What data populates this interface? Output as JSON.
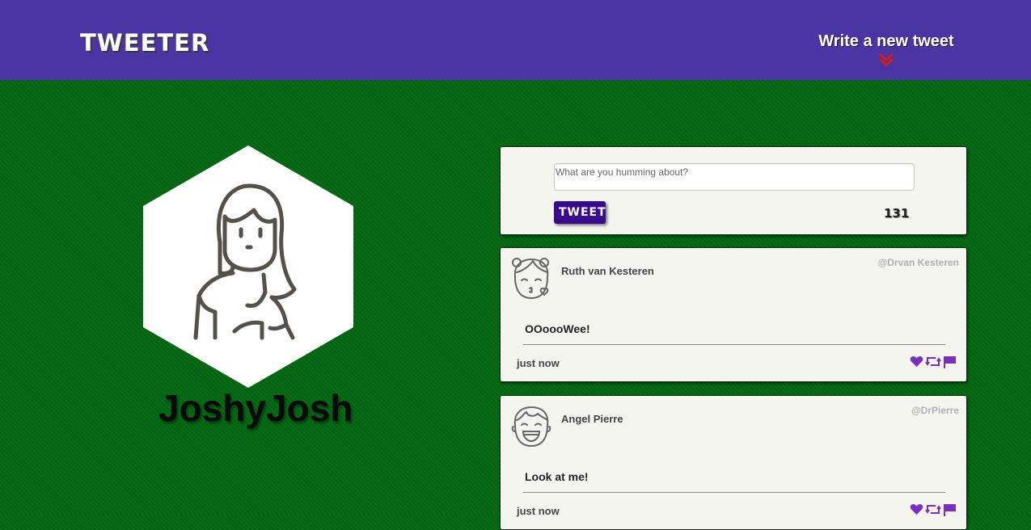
{
  "nav": {
    "brand": "Tweeter",
    "compose_link": "Write a new tweet",
    "arrow_icon": "double-chevron-down-icon",
    "arrow_color": "#d81b1b"
  },
  "profile": {
    "username": "JoshyJosh",
    "avatar_icon": "woman-long-hair-icon"
  },
  "composer": {
    "placeholder": "What are you humming about?",
    "button_label": "Tweet",
    "char_count": "131"
  },
  "tweets": [
    {
      "avatar_icon": "girl-blowing-kiss-icon",
      "name": "Ruth van Kesteren",
      "handle": "@Drvan Kesteren",
      "content": "OOoooWee!",
      "time": "just now"
    },
    {
      "avatar_icon": "smiling-man-icon",
      "name": "Angel Pierre",
      "handle": "@DrPierre",
      "content": "Look at me!",
      "time": "just now"
    }
  ],
  "colors": {
    "nav_bg": "#4b34a4",
    "page_bg": "#02650f",
    "accent": "#7b2fbe",
    "button_bg": "#3a0a8c",
    "card_bg": "#f5f5f0"
  },
  "action_icons": [
    "heart-icon",
    "retweet-icon",
    "flag-icon"
  ]
}
